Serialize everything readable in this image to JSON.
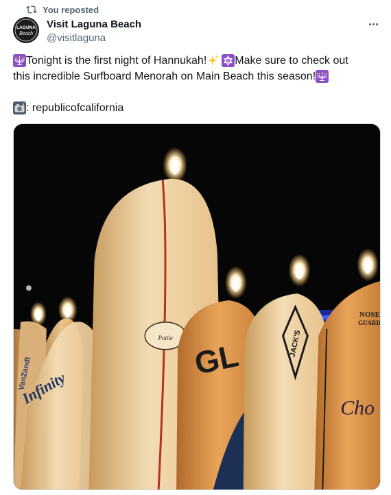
{
  "repost": {
    "label": "You reposted"
  },
  "author": {
    "name": "Visit Laguna Beach",
    "handle": "@visitlaguna",
    "avatar_text_top": "LAGUNA",
    "avatar_text_bottom": "Beach"
  },
  "tweet": {
    "text_part1": "Tonight is the first night of Hannukah!",
    "text_part2": " Make sure to check out",
    "text_line2": "this incredible Surfboard Menorah on Main Beach this season!",
    "credit": ": republicofcalifornia"
  },
  "photo": {
    "board_texts": {
      "pottle": "Pottle",
      "gl": "GL",
      "jacks": "JACK'S",
      "nose": "NOSE",
      "guard": "GUARD",
      "vanzandt": "VanZandt",
      "infinity": "Infinity",
      "chocolate": "Cho"
    }
  },
  "colors": {
    "text": "#0f1419",
    "secondary": "#536471",
    "border": "#cfd9de",
    "emoji_purple": "#8a4fc8"
  },
  "icons": {
    "repost": "repost-icon",
    "more": "more-icon",
    "menorah": "menorah-emoji",
    "sparkles": "sparkles-emoji",
    "star": "star-of-david-emoji",
    "camera": "camera-flash-emoji"
  }
}
